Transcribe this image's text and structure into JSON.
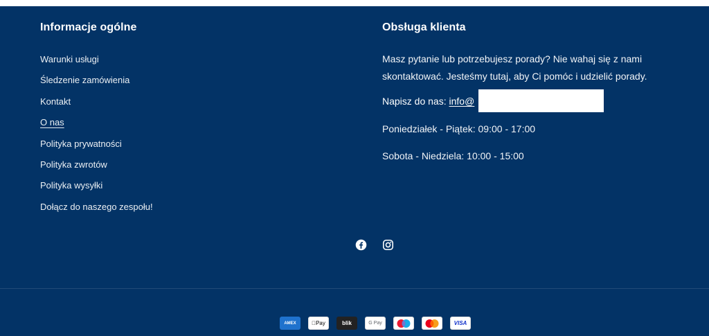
{
  "general": {
    "title": "Informacje ogólne",
    "links": [
      {
        "label": "Warunki usługi"
      },
      {
        "label": "Śledzenie zamówienia"
      },
      {
        "label": "Kontakt"
      },
      {
        "label": "O nas"
      },
      {
        "label": "Polityka prywatności"
      },
      {
        "label": "Polityka zwrotów"
      },
      {
        "label": "Polityka wysyłki"
      },
      {
        "label": "Dołącz do naszego zespołu!"
      }
    ]
  },
  "support": {
    "title": "Obsługa klienta",
    "description": "Masz pytanie lub potrzebujesz porady? Nie wahaj się z nami skontaktować. Jesteśmy tutaj, aby Ci pomóc i udzielić porady.",
    "write_prefix": "Napisz do nas: ",
    "email_visible": "info@",
    "hours_weekdays": "Poniedziałek - Piątek: 09:00 - 17:00",
    "hours_weekend": "Sobota - Niedziela: 10:00 - 15:00"
  },
  "social": {
    "icons": [
      "facebook-icon",
      "instagram-icon"
    ]
  },
  "payments": {
    "methods": [
      {
        "icon": "amex-icon",
        "text": "AMEX"
      },
      {
        "icon": "apple-pay-icon",
        "text": "Pay"
      },
      {
        "icon": "blik-icon",
        "text": "blik"
      },
      {
        "icon": "google-pay-icon",
        "text": "G Pay"
      },
      {
        "icon": "maestro-icon",
        "text": ""
      },
      {
        "icon": "mastercard-icon",
        "text": ""
      },
      {
        "icon": "visa-icon",
        "text": "VISA"
      }
    ]
  },
  "colors": {
    "background": "#033366",
    "text": "#ffffff"
  }
}
